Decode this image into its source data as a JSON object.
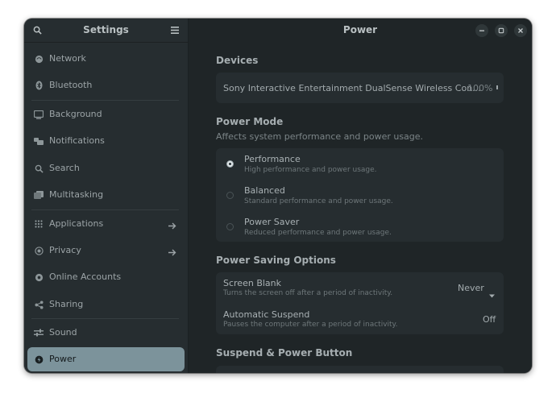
{
  "sidebar": {
    "title": "Settings",
    "items": [
      {
        "label": "Network",
        "icon": "network-icon"
      },
      {
        "label": "Bluetooth",
        "icon": "bluetooth-icon"
      },
      {
        "label": "Background",
        "icon": "background-icon"
      },
      {
        "label": "Notifications",
        "icon": "notifications-icon"
      },
      {
        "label": "Search",
        "icon": "search-icon"
      },
      {
        "label": "Multitasking",
        "icon": "multitasking-icon"
      },
      {
        "label": "Applications",
        "icon": "applications-icon"
      },
      {
        "label": "Privacy",
        "icon": "privacy-icon"
      },
      {
        "label": "Online Accounts",
        "icon": "online-accounts-icon"
      },
      {
        "label": "Sharing",
        "icon": "sharing-icon"
      },
      {
        "label": "Sound",
        "icon": "sound-icon"
      },
      {
        "label": "Power",
        "icon": "power-icon",
        "active": true
      }
    ]
  },
  "content": {
    "title": "Power",
    "devices": {
      "title": "Devices",
      "device_name": "Sony Interactive Entertainment DualSense Wireless Con...",
      "battery": "100%"
    },
    "power_mode": {
      "title": "Power Mode",
      "subtitle": "Affects system performance and power usage.",
      "options": [
        {
          "title": "Performance",
          "subtitle": "High performance and power usage.",
          "selected": true
        },
        {
          "title": "Balanced",
          "subtitle": "Standard performance and power usage.",
          "selected": false
        },
        {
          "title": "Power Saver",
          "subtitle": "Reduced performance and power usage.",
          "selected": false
        }
      ]
    },
    "power_saving": {
      "title": "Power Saving Options",
      "screen_blank": {
        "title": "Screen Blank",
        "subtitle": "Turns the screen off after a period of inactivity.",
        "value": "Never"
      },
      "auto_suspend": {
        "title": "Automatic Suspend",
        "subtitle": "Pauses the computer after a period of inactivity.",
        "value": "Off"
      }
    },
    "suspend_section": {
      "title": "Suspend & Power Button"
    }
  },
  "colors": {
    "window_bg": "#1f2527",
    "sidebar_bg": "#262d30",
    "active_item": "#7c939b",
    "card_bg": "#262d30"
  }
}
